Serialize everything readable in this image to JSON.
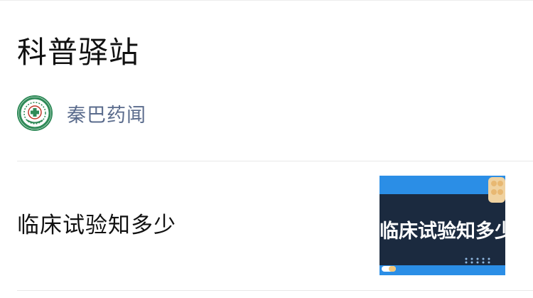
{
  "page": {
    "title": "科普驿站"
  },
  "account": {
    "name": "秦巴药闻",
    "avatar_icon": "hospital-logo-icon",
    "name_color": "#5a6b8c"
  },
  "articles": [
    {
      "title": "临床试验知多少",
      "thumbnail_text": "临床试验知多少",
      "thumbnail_colors": {
        "background": "#2b8ee6",
        "panel": "#1b2a3f"
      }
    }
  ]
}
